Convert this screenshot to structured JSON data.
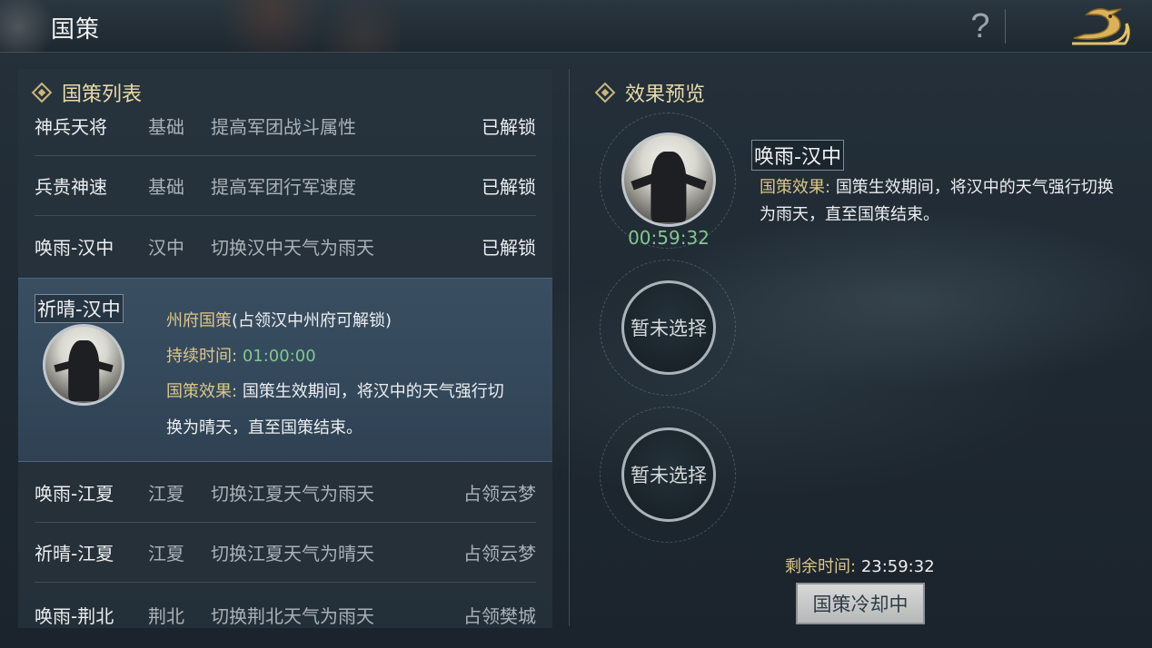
{
  "header": {
    "title": "国策",
    "help": "?"
  },
  "policy_list": {
    "heading": "国策列表",
    "rows_top": [
      {
        "name": "神兵天将",
        "region": "基础",
        "desc": "提高军团战斗属性",
        "status": "已解锁"
      },
      {
        "name": "兵贵神速",
        "region": "基础",
        "desc": "提高军团行军速度",
        "status": "已解锁"
      },
      {
        "name": "唤雨-汉中",
        "region": "汉中",
        "desc": "切换汉中天气为雨天",
        "status": "已解锁"
      }
    ],
    "selected": {
      "name": "祈晴-汉中",
      "type_label": "州府国策",
      "unlock_note": "(占领汉中州府可解锁)",
      "duration_label": "持续时间:",
      "duration_value": "01:00:00",
      "effect_label": "国策效果:",
      "effect_line1": "国策生效期间，将汉中的天气强行切",
      "effect_line2": "换为晴天，直至国策结束。"
    },
    "rows_bottom": [
      {
        "name": "唤雨-江夏",
        "region": "江夏",
        "desc": "切换江夏天气为雨天",
        "status": "占领云梦"
      },
      {
        "name": "祈晴-江夏",
        "region": "江夏",
        "desc": "切换江夏天气为晴天",
        "status": "占领云梦"
      },
      {
        "name": "唤雨-荆北",
        "region": "荆北",
        "desc": "切换荆北天气为雨天",
        "status": "占领樊城"
      }
    ]
  },
  "preview": {
    "heading": "效果预览",
    "active_timer": "00:59:32",
    "active_name": "唤雨-汉中",
    "effect_label": "国策效果:",
    "effect_text": "国策生效期间，将汉中的天气强行切换为雨天，直至国策结束。",
    "empty_slot_1": "暂未选择",
    "empty_slot_2": "暂未选择",
    "remaining_label": "剩余时间:",
    "remaining_value": "23:59:32",
    "cooldown_button": "国策冷却中"
  },
  "colors": {
    "gold": "#dcc68a",
    "green": "#7fc98d",
    "panel": "#28343e"
  }
}
